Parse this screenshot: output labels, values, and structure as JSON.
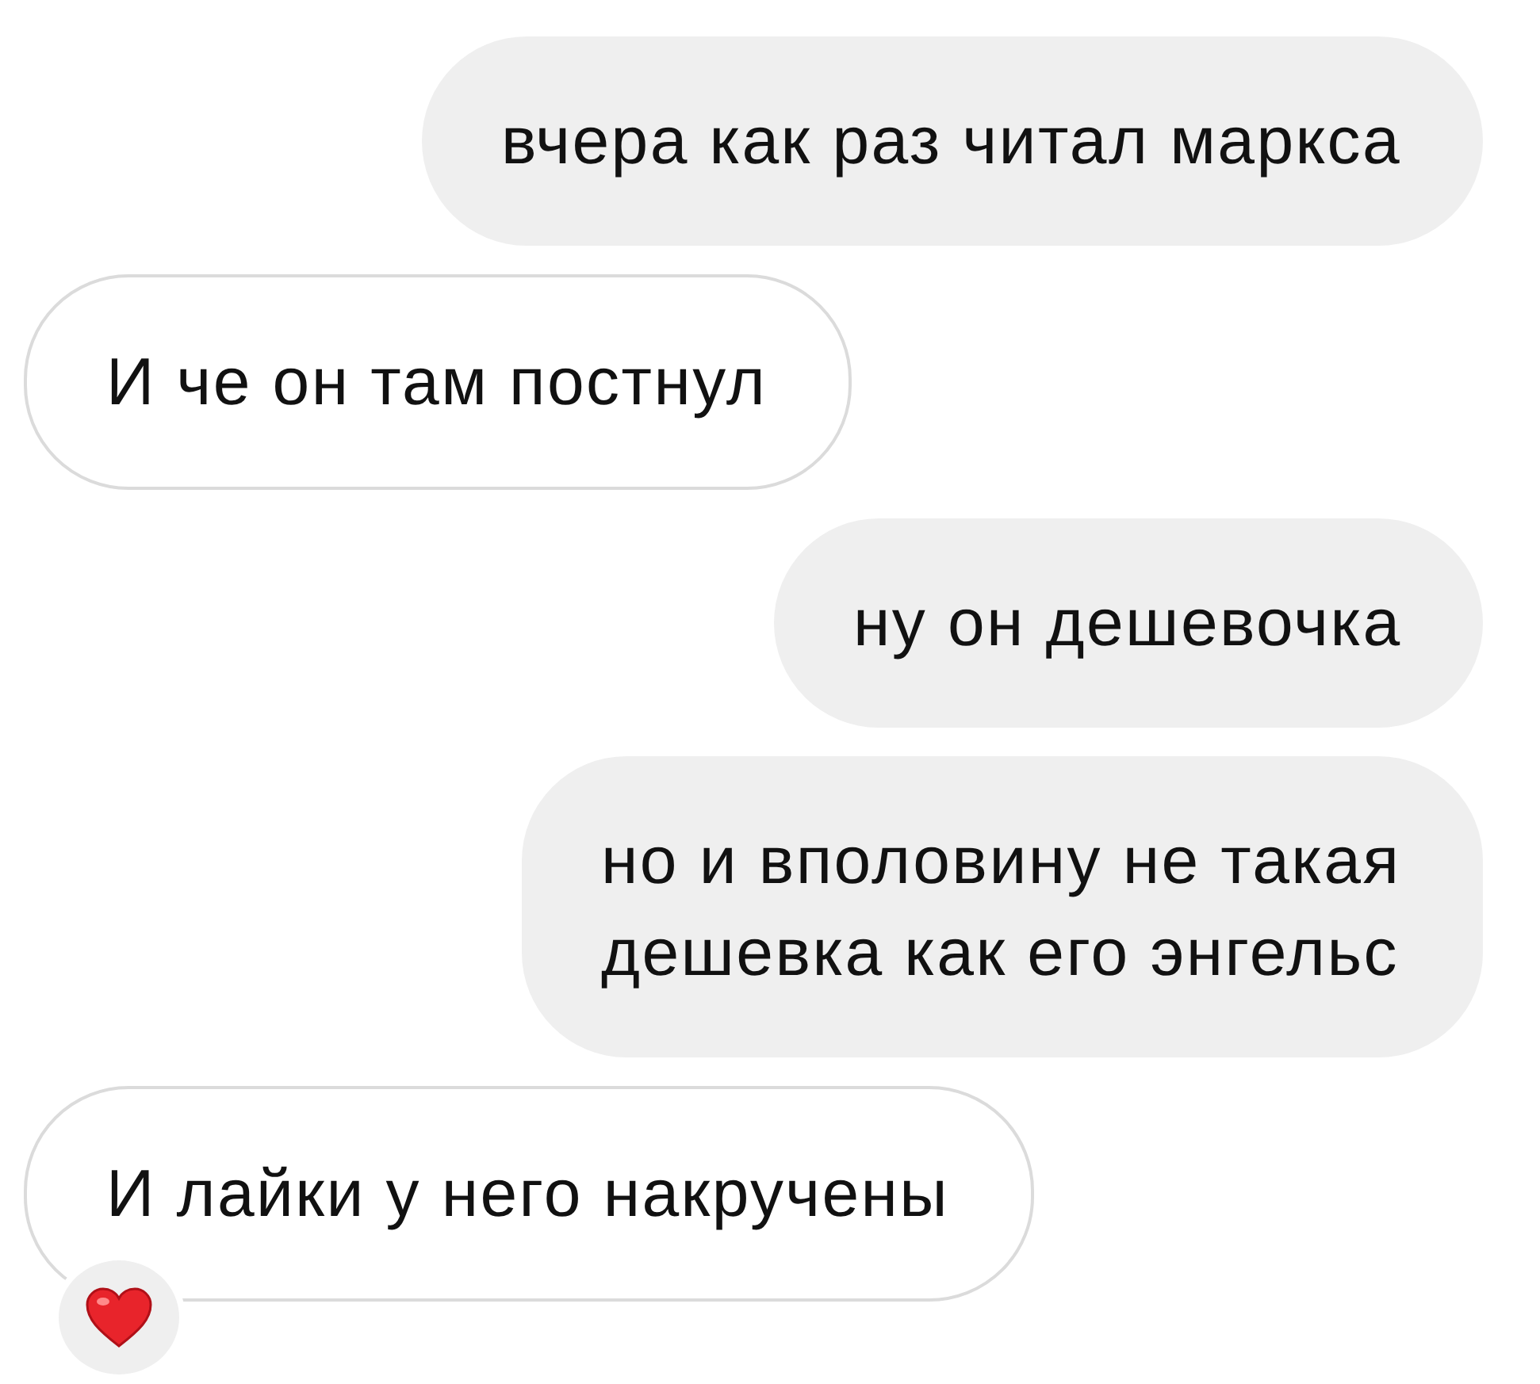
{
  "messages": [
    {
      "kind": "sent",
      "text": "вчера как раз читал маркса"
    },
    {
      "kind": "received",
      "text": "И че он там постнул"
    },
    {
      "kind": "sent",
      "text": "ну он дешевочка"
    },
    {
      "kind": "sent",
      "text": "но и вполовину не такая дешевка как его энгельс"
    },
    {
      "kind": "received",
      "text": "И лайки у него накручены",
      "reaction": {
        "kind": "heart"
      }
    }
  ]
}
